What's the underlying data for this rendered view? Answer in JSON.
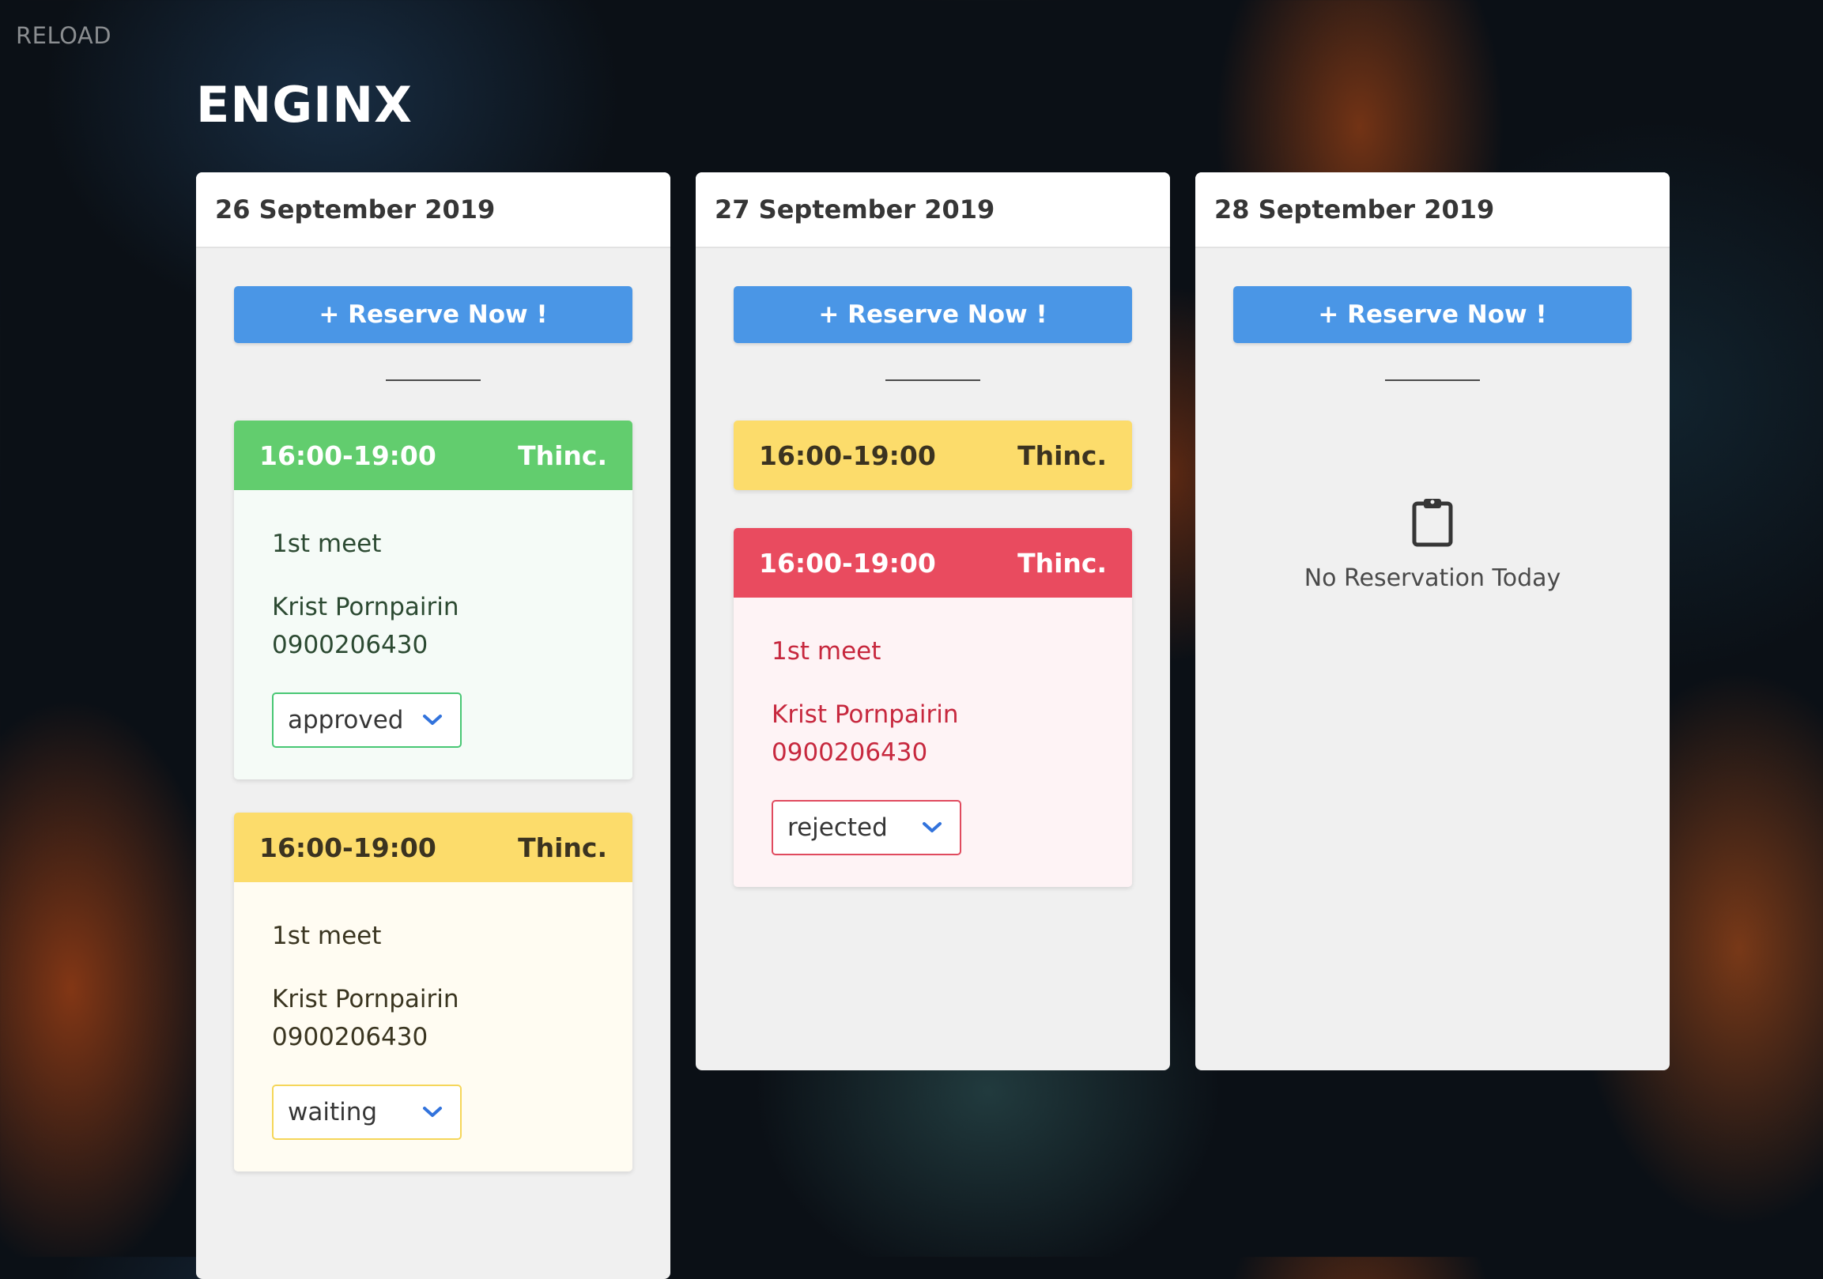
{
  "reload_label": "RELOAD",
  "brand": "ENGINX",
  "reserve_label": "+ Reserve Now !",
  "columns": [
    {
      "date": "26 September 2019",
      "reservations": [
        {
          "time": "16:00-19:00",
          "org": "Thinc.",
          "topic": "1st meet",
          "name": "Krist Pornpairin",
          "phone": "0900206430",
          "status": "approved"
        },
        {
          "time": "16:00-19:00",
          "org": "Thinc.",
          "topic": "1st meet",
          "name": "Krist Pornpairin",
          "phone": "0900206430",
          "status": "waiting"
        }
      ]
    },
    {
      "date": "27 September 2019",
      "reservations": [
        {
          "time": "16:00-19:00",
          "org": "Thinc."
        },
        {
          "time": "16:00-19:00",
          "org": "Thinc.",
          "topic": "1st meet",
          "name": "Krist Pornpairin",
          "phone": "0900206430",
          "status": "rejected"
        }
      ]
    },
    {
      "date": "28 September 2019",
      "empty_text": "No Reservation Today",
      "empty_icon": "clipboard-icon"
    }
  ],
  "colors": {
    "approved": "#62cd6e",
    "waiting": "#fcdc6b",
    "rejected": "#e94b5f",
    "primary_button": "#4a96e6"
  }
}
